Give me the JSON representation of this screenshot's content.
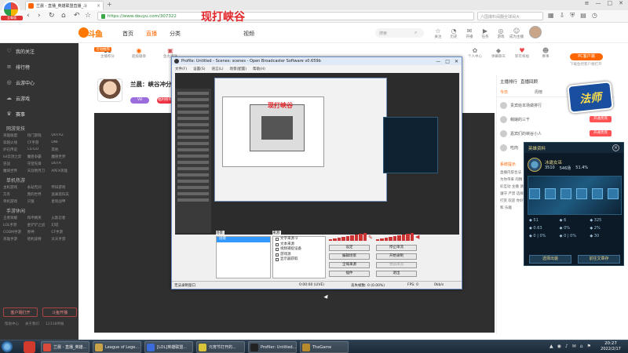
{
  "browser": {
    "badge": "至尊版",
    "tab_title": "兰晨 - 直播_英雄联盟直播_斗",
    "new_tab": "+",
    "url": "https://www.douyu.com/307322",
    "search_placeholder": "六国爆料闹翻全球闹大",
    "win_controls": [
      "≡",
      "—",
      "□",
      "✕"
    ]
  },
  "douyu_header": {
    "logo": "斗鱼",
    "menu": [
      "首页",
      "直播",
      "分类",
      "游戏",
      "视频"
    ],
    "banner": "现打峡谷",
    "search_placeholder": "搜索",
    "icons": [
      {
        "glyph": "☆",
        "label": "关注"
      },
      {
        "glyph": "◔",
        "label": "历史"
      },
      {
        "glyph": "✉",
        "label": "开播"
      },
      {
        "glyph": "▶",
        "label": "任务"
      },
      {
        "glyph": "◎",
        "label": "游戏"
      },
      {
        "glyph": "☺",
        "label": "成为主播"
      }
    ]
  },
  "sidebar": {
    "items": [
      {
        "icon": "♡",
        "label": "我的关注"
      },
      {
        "icon": "≡",
        "label": "排行榜"
      },
      {
        "icon": "◎",
        "label": "云游中心"
      },
      {
        "icon": "☁",
        "label": "云游戏"
      },
      {
        "icon": "♛",
        "label": "赛事"
      }
    ],
    "sections": [
      {
        "title": "网游竞技",
        "games": [
          "英雄联盟",
          "热门游戏",
          "DOTA2",
          "穿越火线",
          "CF手游",
          "DNF",
          "炉石传说",
          "CS:GO",
          "其他",
          "lol云顶之弈",
          "魔兽争霸",
          "魔兽世界",
          "逆战",
          "守望先锋",
          "DOTA",
          "魔域世界",
          "天涯明月刀",
          "APEX英雄"
        ]
      },
      {
        "title": "单机热游",
        "games": [
          "主机游戏",
          "永劫无间",
          "怀旧游戏",
          "方舟",
          "我的世界",
          "逃离塔科夫",
          "单机游戏",
          "只狼",
          "星际战甲"
        ]
      },
      {
        "title": "手游休闲",
        "games": [
          "王者荣耀",
          "和平精英",
          "火影忍者",
          "LOL手游",
          "金铲铲之战",
          "幻塔",
          "CODM手游",
          "原神",
          "CF手游",
          "英雄手游",
          "哈利波特",
          "天天手游"
        ]
      }
    ],
    "bottom_buttons": [
      "客户端打开",
      "斗鱼开播"
    ],
    "footer": [
      "帮助中心",
      "关于我们",
      "12318举报"
    ]
  },
  "category_row": {
    "badge": "活动推荐",
    "cells": [
      {
        "num": "11",
        "label": "主播积分"
      },
      {
        "num": "◉",
        "label": "超级徽章"
      },
      {
        "num": "▣",
        "label": "鱼丸赠送"
      },
      {
        "num": "✿",
        "label": "个人中心"
      },
      {
        "num": "◆",
        "label": "弹幕聊天"
      },
      {
        "num": "♥",
        "label": "新年祝福"
      },
      {
        "num": "☻",
        "label": "赛事"
      }
    ],
    "pc_badge": "PC客户端",
    "pc_sub": "下载鱼吧客户端打开"
  },
  "streamer": {
    "name": "兰晨：峡谷冲分",
    "tag1": "V8",
    "tag2": "福利榜单",
    "avatar_caption": "兰晨说 小兰"
  },
  "right_panel": {
    "tabs": [
      "主播排行",
      "直播回顾",
      "..."
    ],
    "tabs2": [
      "今日",
      "周榜",
      "贵宾",
      "粉丝"
    ],
    "rank": [
      {
        "name": "贵宾给本场做排行",
        "btn": "贵宾席"
      },
      {
        "name": "萌娘的三千",
        "btn": "开通贵宾"
      },
      {
        "name": "嘉宾们的峡谷小人",
        "btn": "开通贵宾"
      },
      {
        "name": "吃肉",
        "btn": "开通贵宾"
      }
    ],
    "notice_title": "系统提示",
    "notice_body": "直播内容合法 为你带来 的精彩互动 主播 请遵守 严禁 选择打赏 欢迎 你好 和 乐趣",
    "logo": "法师"
  },
  "hero_popup": {
    "title": "英雄资料",
    "name": "冰霜女巫",
    "stats": [
      "3510",
      "546场",
      "51.4%"
    ],
    "grid": [
      "◆ 51",
      "◆ 6",
      "◆ 325",
      "◆ 0.63",
      "◆ 0%",
      "◆ 2%",
      "◆ 0 | 0%",
      "◆ 0 | 0%",
      "◆ 30"
    ],
    "btn_left": "选择出装",
    "btn_right": "前往文章存"
  },
  "obs": {
    "title": "Profile: Untitled - Scenes: scenes - Open Broadcaster Software v0.659b",
    "menu": [
      "文件(F)",
      "设置(S)",
      "语言(L)",
      "场景(配置)",
      "帮助(H)"
    ],
    "inner_title": "现打峡谷",
    "scenes_label": "场景:",
    "sources_label": "来源:",
    "scenes": [
      "场景"
    ],
    "sources": [
      "文字来源 0",
      "文本来源",
      "视频捕捉设备",
      "游戏源",
      "显示器获取"
    ],
    "buttons": [
      "设定",
      "停止串流",
      "编辑场景",
      "开始录制",
      "全域来源",
      "预览串流",
      "插件",
      "退出"
    ],
    "status": [
      "无法录制窗口",
      "0:00:00 (LIVE)",
      "丢失帧数: 0 (0.00%)",
      "FPS: 0",
      "0kb/s"
    ]
  },
  "taskbar": {
    "apps": [
      {
        "label": "兰晨 - 直播_英雄...",
        "color": "#d94a3a"
      },
      {
        "label": "League of Lege...",
        "color": "#c9a34a"
      },
      {
        "label": "[LOL]英雄联盟...",
        "color": "#3a6bd9"
      },
      {
        "label": "元宵节打开的...",
        "color": "#d9c43a"
      },
      {
        "label": "Profiler: Untitled...",
        "color": "#222222"
      },
      {
        "label": "TheGame",
        "color": "#b88a2e"
      }
    ],
    "tray": [
      "▲",
      "◉",
      "♪",
      "✉",
      "⌂",
      "⚑"
    ],
    "time": "20:27",
    "date": "2022/2/17"
  }
}
